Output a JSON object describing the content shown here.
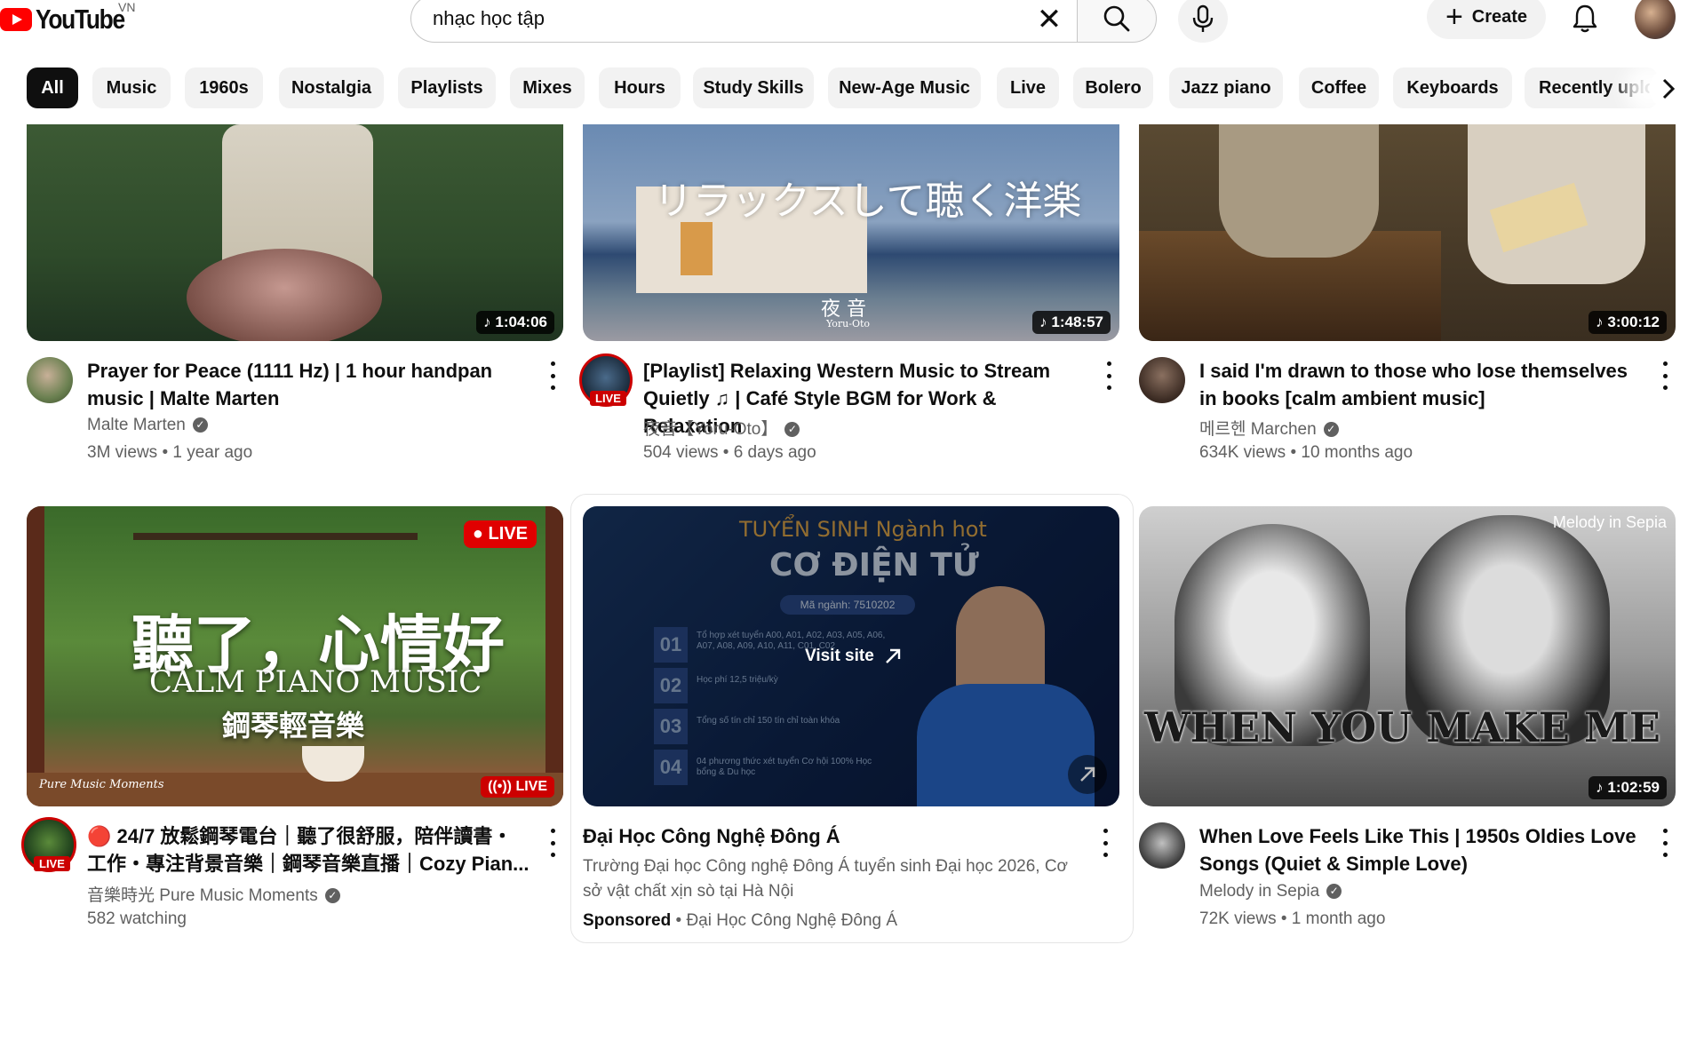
{
  "header": {
    "logo_text": "YouTube",
    "country_code": "VN",
    "search_value": "nhạc học tập",
    "search_clear": "✕",
    "create_label": "Create"
  },
  "chips": [
    "All",
    "Music",
    "1960s",
    "Nostalgia",
    "Playlists",
    "Mixes",
    "Hours",
    "Study Skills",
    "New-Age Music",
    "Live",
    "Bolero",
    "Jazz piano",
    "Coffee",
    "Keyboards",
    "Recently uploaded"
  ],
  "videos": [
    {
      "title": "Prayer for Peace (1111 Hz) | 1 hour handpan music | Malte Marten",
      "channel": "Malte Marten",
      "stats": "3M views • 1 year ago",
      "duration": "♪ 1:04:06"
    },
    {
      "title": "[Playlist] Relaxing Western Music to Stream Quietly ♫ | Café Style BGM for Work & Relaxation",
      "channel": "夜音【Yoru-Oto】",
      "stats": "504 views • 6 days ago",
      "duration": "♪ 1:48:57",
      "thumb_text": "リラックスして聴く洋楽",
      "thumb_sub": "夜 音",
      "thumb_sub2": "Yoru-Oto",
      "avatar_live": "LIVE"
    },
    {
      "title": "I said I'm drawn to those who lose themselves in books [calm ambient music]",
      "channel": "메르헨 Marchen",
      "stats": "634K views • 10 months ago",
      "duration": "♪ 3:00:12"
    },
    {
      "title": "🔴 24/7 放鬆鋼琴電台｜聽了很舒服，陪伴讀書・工作・專注背景音樂｜鋼琴音樂直播｜Cozy Pian...",
      "channel": "音樂時光 Pure Music Moments",
      "stats": "582 watching",
      "live_top": "● LIVE",
      "live_bottom": "((•)) LIVE",
      "avatar_live": "LIVE",
      "thumb_text": "聽了，心情好",
      "thumb_sub": "CALM PIANO MUSIC",
      "thumb_sub2": "鋼琴輕音樂",
      "thumb_brand": "Pure Music Moments"
    },
    {
      "title": "Đại Học Công Nghệ Đông Á",
      "description": "Trường Đại học Công nghệ Đông Á tuyển sinh Đại học 2026, Cơ sở vật chất xịn sò tại Hà Nội",
      "sponsored": "Sponsored",
      "advertiser": " • Đại Học Công Nghệ Đông Á",
      "visit_site": "Visit site",
      "ad_heading": "TUYỂN SINH Ngành hot",
      "ad_major": "CƠ ĐIỆN TỬ",
      "ad_code": "Mã ngành: 7510202",
      "ad_rows": [
        {
          "num": "01",
          "text": "Tổ hợp xét tuyển A00, A01, A02, A03, A05, A06, A07, A08, A09, A10, A11, C01, C02"
        },
        {
          "num": "02",
          "text": "Học phí 12,5 triệu/kỳ"
        },
        {
          "num": "03",
          "text": "Tổng số tín chỉ 150 tín chỉ toàn khóa"
        },
        {
          "num": "04",
          "text": "04 phương thức xét tuyển Cơ hội 100% Học bổng & Du học"
        }
      ]
    },
    {
      "title": "When Love Feels Like This | 1950s Oldies Love Songs (Quiet & Simple Love)",
      "channel": "Melody in Sepia",
      "stats": "72K views • 1 month ago",
      "duration": "♪ 1:02:59",
      "thumb_text": "WHEN YOU MAKE ME SMILE",
      "thumb_brand": "Melody in Sepia"
    }
  ]
}
